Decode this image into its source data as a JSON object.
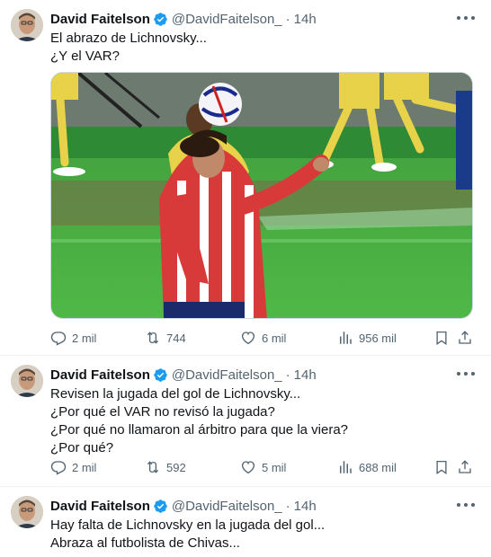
{
  "colors": {
    "verified_blue": "#1d9bf0",
    "secondary_text": "#536471",
    "primary_text": "#0f1419"
  },
  "tweets": [
    {
      "author_name": "David Faitelson",
      "handle": "@DavidFaitelson_",
      "separator": "·",
      "time": "14h",
      "text_lines": [
        "El abrazo de Lichnovsky...",
        "¿Y el VAR?"
      ],
      "has_media": true,
      "replies": "2 mil",
      "retweets": "744",
      "likes": "6 mil",
      "views": "956 mil"
    },
    {
      "author_name": "David Faitelson",
      "handle": "@DavidFaitelson_",
      "separator": "·",
      "time": "14h",
      "text_lines": [
        "Revisen la jugada del gol de Lichnovsky...",
        "¿Por qué el VAR no revisó la jugada?",
        "¿Por qué no llamaron al árbitro para que la viera?",
        "¿Por qué?"
      ],
      "has_media": false,
      "replies": "2 mil",
      "retweets": "592",
      "likes": "5 mil",
      "views": "688 mil"
    },
    {
      "author_name": "David Faitelson",
      "handle": "@DavidFaitelson_",
      "separator": "·",
      "time": "14h",
      "text_lines": [
        "Hay falta de Lichnovsky en la jugada del gol...",
        "Abraza al futbolista de Chivas..."
      ],
      "has_media": false
    }
  ],
  "icons": {
    "verified": "verified-badge-icon",
    "more": "more-options-icon",
    "reply": "reply-icon",
    "retweet": "retweet-icon",
    "like": "heart-icon",
    "views": "views-chart-icon",
    "bookmark": "bookmark-icon",
    "share": "share-icon"
  }
}
